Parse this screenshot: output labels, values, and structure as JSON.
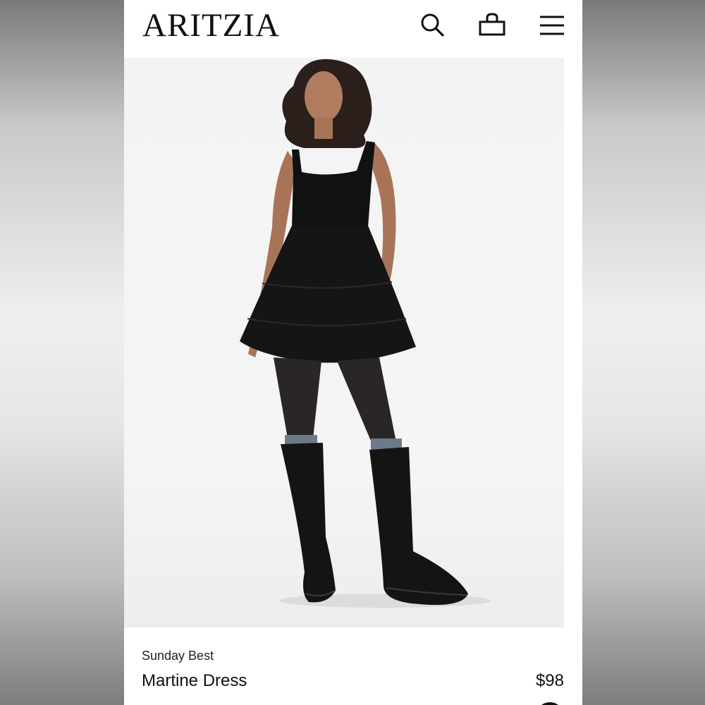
{
  "header": {
    "logo": "ARITZIA",
    "icons": [
      "search-icon",
      "bag-icon",
      "menu-icon"
    ]
  },
  "product": {
    "brand": "Sunday Best",
    "name": "Martine Dress",
    "price": "$98",
    "swatch_color": "#111111"
  }
}
